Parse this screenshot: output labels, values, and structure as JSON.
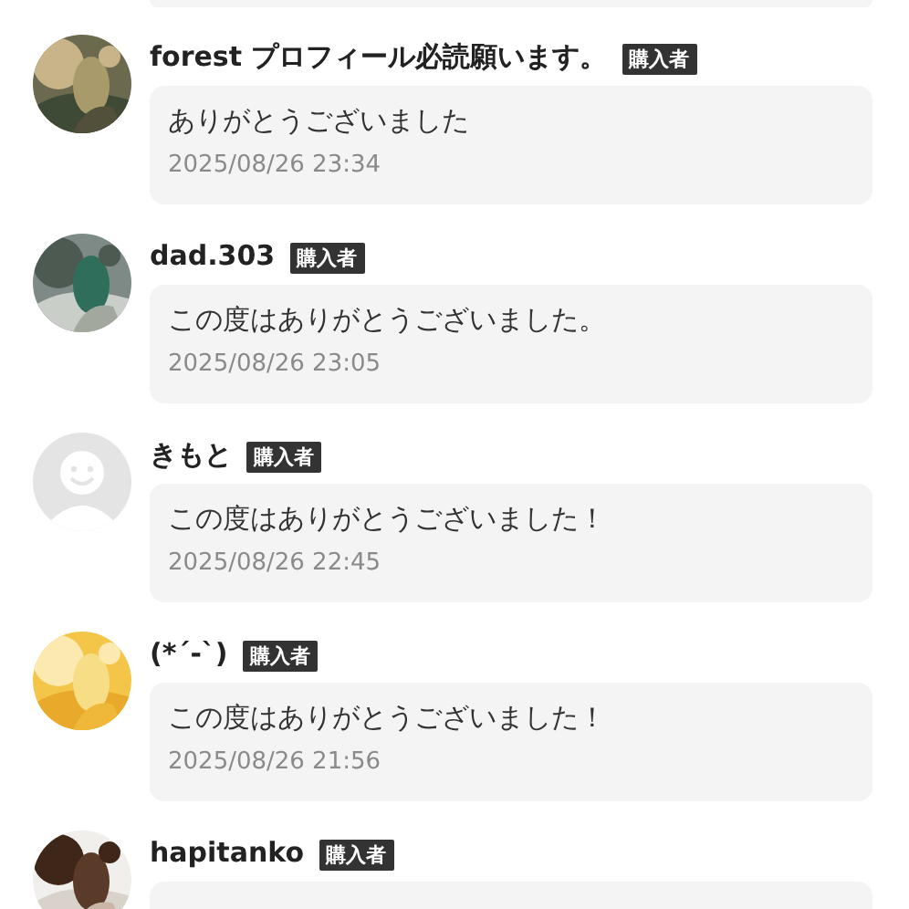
{
  "reviews": [
    {
      "name": "forest プロフィール必読願います。",
      "badge": "購入者",
      "message": "ありがとうございました",
      "date": "2025/08/26 23:34"
    },
    {
      "name": "dad.303",
      "badge": "購入者",
      "message": "この度はありがとうございました。",
      "date": "2025/08/26 23:05"
    },
    {
      "name": "きもと",
      "badge": "購入者",
      "kind": "default",
      "message": "この度はありがとうございました！",
      "date": "2025/08/26 22:45"
    },
    {
      "name": "(*´-`)",
      "badge": "購入者",
      "message": "この度はありがとうございました！",
      "date": "2025/08/26 21:56"
    },
    {
      "name": "hapitanko",
      "badge": "購入者"
    }
  ]
}
